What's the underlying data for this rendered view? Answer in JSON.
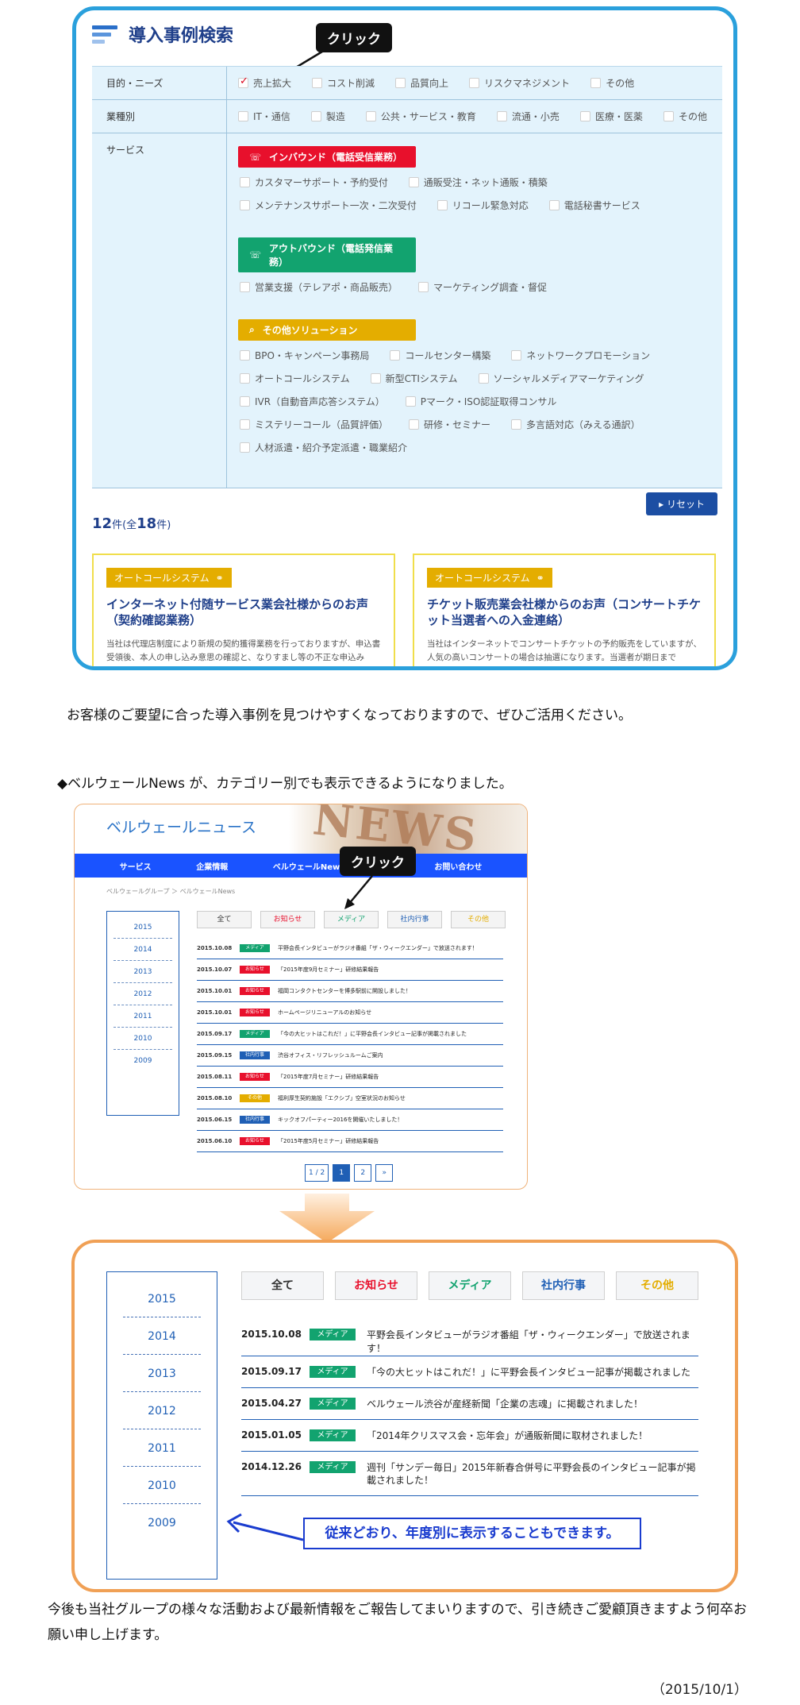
{
  "search": {
    "title": "導入事例検索",
    "callout": "クリック",
    "rows": [
      {
        "label": "目的・ニーズ",
        "options": [
          {
            "text": "売上拡大",
            "checked": true
          },
          {
            "text": "コスト削減",
            "checked": false
          },
          {
            "text": "品質向上",
            "checked": false
          },
          {
            "text": "リスクマネジメント",
            "checked": false
          },
          {
            "text": "その他",
            "checked": false
          }
        ]
      },
      {
        "label": "業種別",
        "options": [
          {
            "text": "IT・通信",
            "checked": false
          },
          {
            "text": "製造",
            "checked": false
          },
          {
            "text": "公共・サービス・教育",
            "checked": false
          },
          {
            "text": "流通・小売",
            "checked": false
          },
          {
            "text": "医療・医薬",
            "checked": false
          },
          {
            "text": "その他",
            "checked": false
          }
        ]
      }
    ],
    "service_label": "サービス",
    "service_groups": [
      {
        "title": "インバウンド（電話受信業務）",
        "color": "red",
        "items": [
          "カスタマーサポート・予約受付",
          "通販受注・ネット通販・積築",
          "メンテナンスサポート一次・二次受付",
          "リコール緊急対応",
          "電話秘書サービス"
        ]
      },
      {
        "title": "アウトバウンド（電話発信業務）",
        "color": "green",
        "items": [
          "営業支援（テレアポ・商品販売）",
          "マーケティング調査・督促"
        ]
      },
      {
        "title": "その他ソリューション",
        "color": "gold",
        "items": [
          "BPO・キャンペーン事務局",
          "コールセンター構築",
          "ネットワークプロモーション",
          "オートコールシステム",
          "新型CTIシステム",
          "ソーシャルメディアマーケティング",
          "IVR（自動音声応答システム）",
          "Pマーク・ISO認証取得コンサル",
          "ミステリーコール（品質評価）",
          "研修・セミナー",
          "多言語対応（みえる通訳）",
          "人材派遣・紹介予定派遣・職業紹介"
        ]
      }
    ],
    "reset_label": "リセット",
    "count": "12",
    "count_pre": "件(全",
    "total": "18",
    "count_post": "件)",
    "cards": [
      {
        "tag": "オートコールシステム",
        "caption": "インターネット付随サービス業会社様からのお声（契約確認業務）",
        "desc": "当社は代理店制度により新規の契約獲得業務を行っておりますが、申込書受領後、本人の申し込み意思の確認と、なりすまし等の不正な申込み"
      },
      {
        "tag": "オートコールシステム",
        "caption": "チケット販売業会社様からのお声（コンサートチケット当選者への入金連絡）",
        "desc": "当社はインターネットでコンサートチケットの予約販売をしていますが、人気の高いコンサートの場合は抽選になります。当選者が期日まで"
      }
    ]
  },
  "text": {
    "para1": "お客様のご要望に合った導入事例を見つけやすくなっておりますので、ぜひご活用ください。",
    "para2": "◆ベルウェールNews が、カテゴリー別でも表示できるようになりました。",
    "para3": "今後も当社グループの様々な活動および最新情報をご報告してまいりますので、引き続きご愛顧頂きますよう何卒お願い申し上げます。",
    "date": "（2015/10/1）"
  },
  "news_page": {
    "title": "ベルウェールニュース",
    "art_word": "NEWS",
    "callout": "クリック",
    "nav": [
      "サービス",
      "企業情報",
      "ベルウェールNews",
      "",
      "お問い合わせ"
    ],
    "breadcrumb": "ベルウェールグループ ＞ ベルウェールNews",
    "years": [
      "2015",
      "2014",
      "2013",
      "2012",
      "2011",
      "2010",
      "2009"
    ],
    "tabs": [
      "全て",
      "お知らせ",
      "メディア",
      "社内行事",
      "その他"
    ],
    "tab_colors": [
      "#333333",
      "#e8102c",
      "#12a36f",
      "#1f5fb5",
      "#e4ad00"
    ],
    "items": [
      {
        "date": "2015.10.08",
        "badge": "メディア",
        "color": "#12a36f",
        "title": "平野会長インタビューがラジオ番組「ザ・ウィークエンダー」で放送されます！"
      },
      {
        "date": "2015.10.07",
        "badge": "お知らせ",
        "color": "#e8102c",
        "title": "「2015年度9月セミナー」研修結果報告"
      },
      {
        "date": "2015.10.01",
        "badge": "お知らせ",
        "color": "#e8102c",
        "title": "福岡コンタクトセンターを博多駅前に開設しました！"
      },
      {
        "date": "2015.10.01",
        "badge": "お知らせ",
        "color": "#e8102c",
        "title": "ホームページリニューアルのお知らせ"
      },
      {
        "date": "2015.09.17",
        "badge": "メディア",
        "color": "#12a36f",
        "title": "「今の大ヒットはこれだ！」に平野会長インタビュー記事が掲載されました"
      },
      {
        "date": "2015.09.15",
        "badge": "社内行事",
        "color": "#1f5fb5",
        "title": "渋谷オフィス・リフレッシュルームご案内"
      },
      {
        "date": "2015.08.11",
        "badge": "お知らせ",
        "color": "#e8102c",
        "title": "「2015年度7月セミナー」研修結果報告"
      },
      {
        "date": "2015.08.10",
        "badge": "その他",
        "color": "#e4ad00",
        "title": "福利厚生契約施設「エクシブ」空室状況のお知らせ"
      },
      {
        "date": "2015.06.15",
        "badge": "社内行事",
        "color": "#1f5fb5",
        "title": "キックオフパーティー2016を開催いたしました！"
      },
      {
        "date": "2015.06.10",
        "badge": "お知らせ",
        "color": "#e8102c",
        "title": "「2015年度5月セミナー」研修結果報告"
      }
    ],
    "pager": [
      "1 / 2",
      "1",
      "2",
      "»"
    ]
  },
  "news_detail": {
    "years": [
      "2015",
      "2014",
      "2013",
      "2012",
      "2011",
      "2010",
      "2009"
    ],
    "tabs": [
      "全て",
      "お知らせ",
      "メディア",
      "社内行事",
      "その他"
    ],
    "tab_colors": [
      "#333333",
      "#e8102c",
      "#12a36f",
      "#1f5fb5",
      "#e4ad00"
    ],
    "items": [
      {
        "date": "2015.10.08",
        "badge": "メディア",
        "title": "平野会長インタビューがラジオ番組「ザ・ウィークエンダー」で放送されます！"
      },
      {
        "date": "2015.09.17",
        "badge": "メディア",
        "title": "「今の大ヒットはこれだ！」に平野会長インタビュー記事が掲載されました"
      },
      {
        "date": "2015.04.27",
        "badge": "メディア",
        "title": "ベルウェール渋谷が産経新聞「企業の志魂」に掲載されました！"
      },
      {
        "date": "2015.01.05",
        "badge": "メディア",
        "title": "「2014年クリスマス会・忘年会」が通販新聞に取材されました！"
      },
      {
        "date": "2014.12.26",
        "badge": "メディア",
        "title": "週刊「サンデー毎日」2015年新春合併号に平野会長のインタビュー記事が掲載されました！"
      }
    ],
    "note": "従来どおり、年度別に表示することもできます。"
  }
}
